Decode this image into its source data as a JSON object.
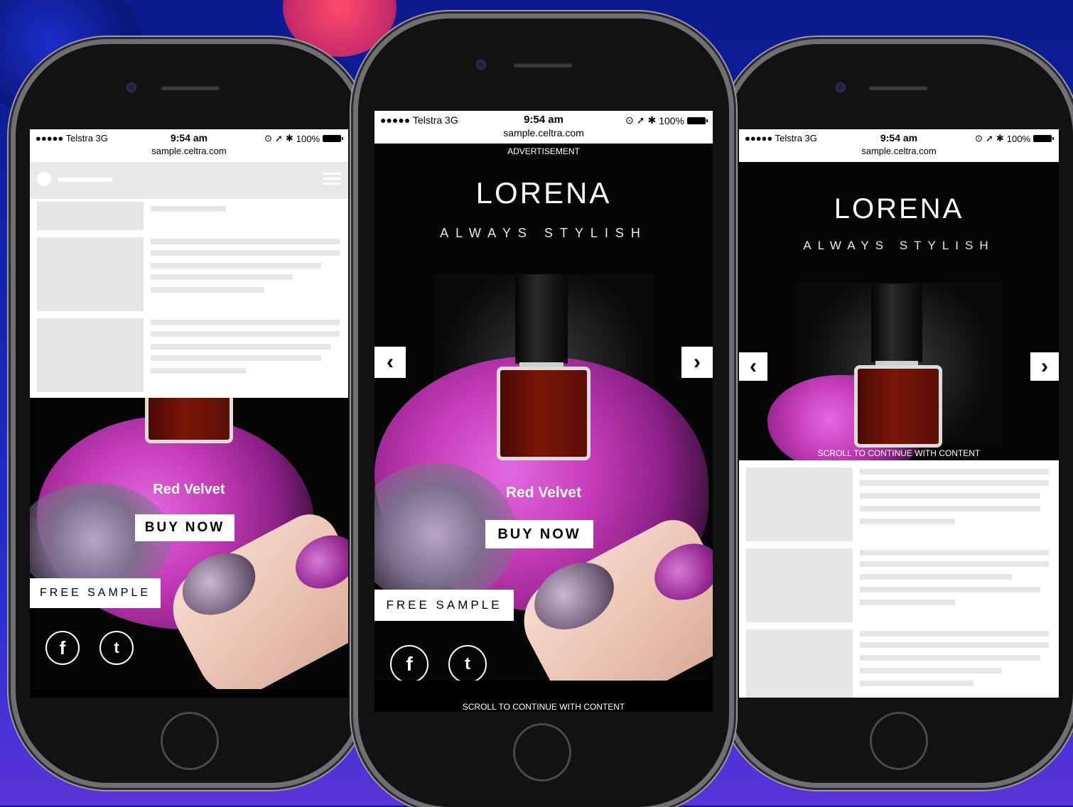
{
  "status_bar": {
    "carrier": "●●●●● Telstra   3G",
    "time": "9:54 am",
    "battery": "100%",
    "url": "sample.celtra.com"
  },
  "ad": {
    "advertisement_label": "ADVERTISEMENT",
    "brand": "LORENA",
    "tagline": "ALWAYS STYLISH",
    "product_name": "Red Velvet",
    "buy_now": "BUY NOW",
    "free_sample": "FREE SAMPLE",
    "scroll_label": "SCROLL TO CONTINUE WITH CONTENT",
    "prev_arrow": "‹",
    "next_arrow": "›",
    "facebook": "f",
    "twitter": "t"
  },
  "colors": {
    "background": "#1226b0",
    "polish": "#7a1608",
    "glitter": "#c43bb6"
  }
}
